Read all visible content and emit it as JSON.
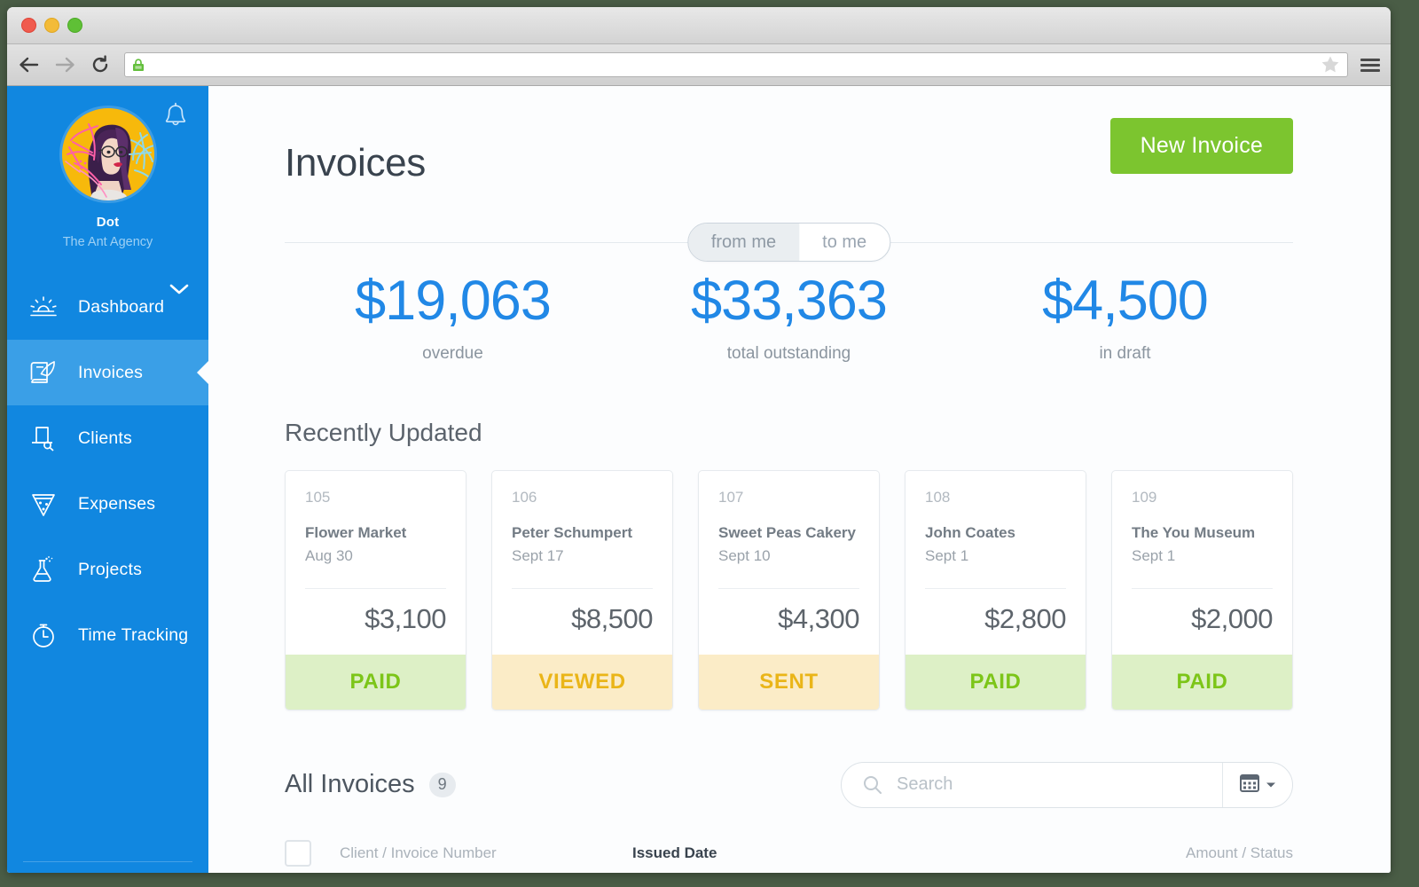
{
  "browser": {
    "url": "",
    "url_placeholder": "",
    "lock_icon": "lock-icon",
    "back_icon": "back-arrow-icon",
    "forward_icon": "forward-arrow-icon",
    "reload_icon": "reload-icon",
    "star_icon": "star-icon",
    "menu_icon": "hamburger-menu-icon"
  },
  "sidebar": {
    "bell_icon": "bell-icon",
    "avatar_alt": "user-avatar",
    "user_name": "Dot",
    "company": "The Ant Agency",
    "chevron_icon": "chevron-down-icon",
    "items": [
      {
        "label": "Dashboard",
        "icon": "sunrise-icon",
        "active": false
      },
      {
        "label": "Invoices",
        "icon": "invoice-quill-icon",
        "active": true
      },
      {
        "label": "Clients",
        "icon": "top-hat-icon",
        "active": false
      },
      {
        "label": "Expenses",
        "icon": "pizza-slice-icon",
        "active": false
      },
      {
        "label": "Projects",
        "icon": "flask-icon",
        "active": false
      },
      {
        "label": "Time Tracking",
        "icon": "stopwatch-icon",
        "active": false
      }
    ]
  },
  "header": {
    "title": "Invoices",
    "new_invoice_label": "New Invoice"
  },
  "toggle": {
    "options": [
      "from me",
      "to me"
    ],
    "selected": "from me"
  },
  "stats": [
    {
      "value": "$19,063",
      "caption": "overdue"
    },
    {
      "value": "$33,363",
      "caption": "total outstanding"
    },
    {
      "value": "$4,500",
      "caption": "in draft"
    }
  ],
  "recently_updated": {
    "title": "Recently Updated",
    "cards": [
      {
        "number": "105",
        "client": "Flower Market",
        "date": "Aug 30",
        "amount": "$3,100",
        "status": "PAID",
        "status_class": "st-paid"
      },
      {
        "number": "106",
        "client": "Peter Schumpert",
        "date": "Sept 17",
        "amount": "$8,500",
        "status": "VIEWED",
        "status_class": "st-viewed"
      },
      {
        "number": "107",
        "client": "Sweet Peas Cakery",
        "date": "Sept 10",
        "amount": "$4,300",
        "status": "SENT",
        "status_class": "st-sent"
      },
      {
        "number": "108",
        "client": "John Coates",
        "date": "Sept 1",
        "amount": "$2,800",
        "status": "PAID",
        "status_class": "st-paid"
      },
      {
        "number": "109",
        "client": "The You Museum",
        "date": "Sept 1",
        "amount": "$2,000",
        "status": "PAID",
        "status_class": "st-paid"
      }
    ]
  },
  "all_invoices": {
    "title": "All Invoices",
    "count": "9",
    "search_placeholder": "Search",
    "search_value": "",
    "search_icon": "search-icon",
    "calendar_icon": "calendar-icon",
    "calendar_caret_icon": "caret-down-icon",
    "columns": [
      {
        "label": "Client / Invoice Number",
        "active": false
      },
      {
        "label": "Issued Date",
        "active": true
      },
      {
        "label": "Amount / Status",
        "active": false
      }
    ],
    "select_all_checkbox": "select-all-checkbox"
  },
  "colors": {
    "sidebar_blue": "#1187e0",
    "sidebar_active": "#3a9fe7",
    "accent_blue": "#2188e6",
    "green_button": "#7cc52f",
    "paid_bg": "#ddf0c6",
    "paid_text": "#7cc518",
    "viewed_bg": "#fbecc7",
    "viewed_text": "#eab518"
  }
}
